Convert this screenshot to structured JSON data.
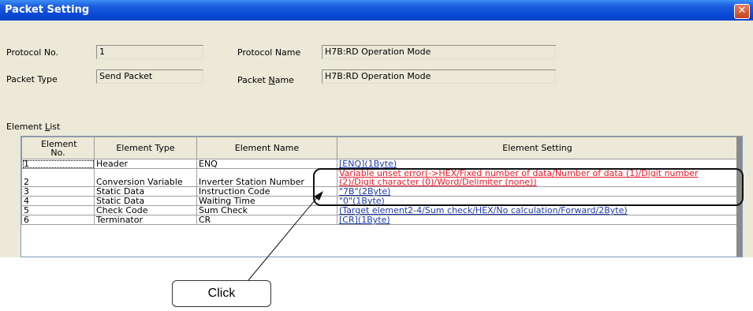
{
  "window": {
    "title": "Packet Setting",
    "close_symbol": "✕"
  },
  "fields": {
    "protocol_no": {
      "label": "Protocol No.",
      "value": "1"
    },
    "packet_type": {
      "label": "Packet Type",
      "value": "Send Packet"
    },
    "protocol_name": {
      "label": "Protocol Name",
      "value": "H7B:RD Operation Mode"
    },
    "packet_name": {
      "label_before": "Packet ",
      "label_accel": "N",
      "label_after": "ame",
      "value": "H7B:RD Operation Mode"
    }
  },
  "element_list": {
    "label_before": "Element ",
    "label_accel": "L",
    "label_after": "ist",
    "columns": [
      "Element No.",
      "Element Type",
      "Element Name",
      "Element Setting"
    ],
    "rows": [
      {
        "no": "1",
        "type": "Header",
        "name": "ENQ",
        "setting": "[ENQ](1Byte)"
      },
      {
        "no": "2",
        "type": "Conversion Variable",
        "name": "Inverter Station Number",
        "setting": "Variable unset error(->HEX/Fixed number of data/Number of data (1)/Digit number (2)/Digit character (0)/Word/Delimiter (none))"
      },
      {
        "no": "3",
        "type": "Static Data",
        "name": "Instruction Code",
        "setting": "\"7B\"(2Byte)"
      },
      {
        "no": "4",
        "type": "Static Data",
        "name": "Waiting Time",
        "setting": "\"0\"(1Byte)"
      },
      {
        "no": "5",
        "type": "Check Code",
        "name": "Sum Check",
        "setting": "(Target element2-4/Sum check/HEX/No calculation/Forward/2Byte)"
      },
      {
        "no": "6",
        "type": "Terminator",
        "name": "CR",
        "setting": "[CR](1Byte)"
      }
    ]
  },
  "annotation": {
    "callout": "Click"
  },
  "colors": {
    "titlebar": "#0a49d6",
    "error_text": "#e21c2a",
    "link_text": "#1e3aa8",
    "dialog_bg": "#ece9d8"
  }
}
